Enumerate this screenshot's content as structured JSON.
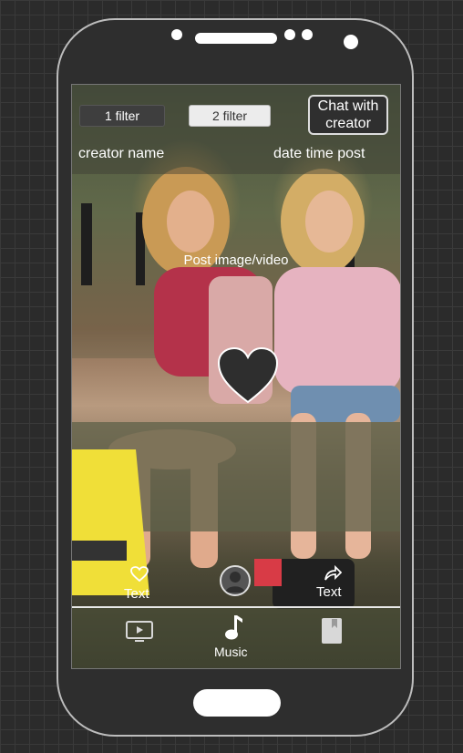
{
  "header": {
    "filter1_label": "1 filter",
    "filter2_label": "2 filter",
    "chat_label_line1": "Chat with",
    "chat_label_line2": "creator",
    "creator_name": "creator name",
    "date_time": "date time post"
  },
  "post": {
    "center_label": "Post image/video"
  },
  "actions": {
    "like_label": "Text",
    "share_label": "Text"
  },
  "bottom_nav": {
    "music_label": "Music",
    "icons": [
      "video-icon",
      "music-note-icon",
      "bookmark-icon"
    ]
  },
  "colors": {
    "phone_body": "#2e2e2e",
    "background": "#2b2b2b",
    "accent": "#ffffff"
  }
}
